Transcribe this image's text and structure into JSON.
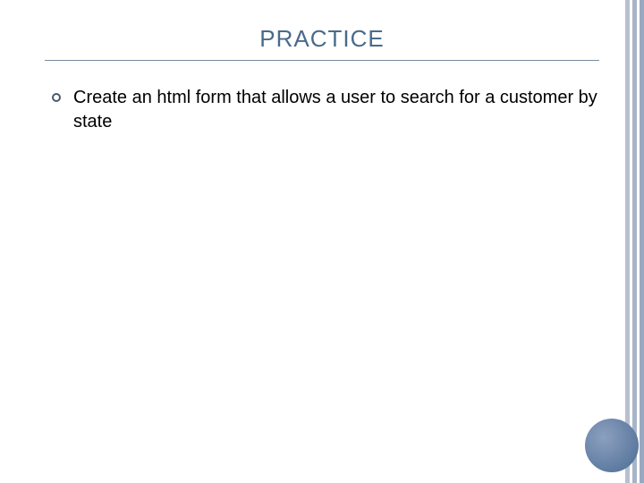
{
  "title": "PRACTICE",
  "bullets": [
    "Create an html form that allows a user to search for a customer by state"
  ],
  "colors": {
    "title": "#4a6a8a",
    "stripe": "#a8b4c8",
    "circle": "#5e7ba0"
  }
}
